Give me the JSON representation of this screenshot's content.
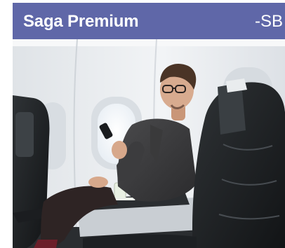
{
  "banner": {
    "title": "Saga Premium",
    "code": "-SB",
    "header_color": "#5f67a8"
  },
  "photo": {
    "subject": "premium-cabin-passenger",
    "icon": "airplane-window"
  }
}
